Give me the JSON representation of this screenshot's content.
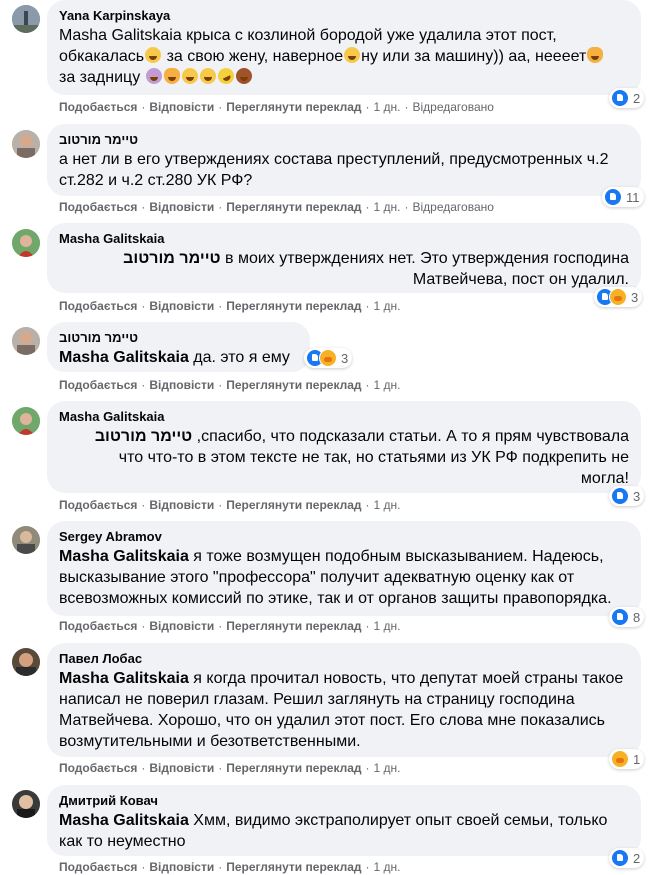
{
  "colors": {
    "bubble": "#f0f2f5",
    "meta": "#65676b",
    "like_blue": "#1877f2",
    "care_yellow": "#f7b125"
  },
  "actions": {
    "like": "Подобається",
    "reply": "Відповісти",
    "translate": "Переглянути переклад",
    "sep": "·"
  },
  "comments": [
    {
      "author": "Yana Karpinskaya",
      "lines": [
        "Masha Galitskaia крыса с козлиной бородой уже удалила этот пост,",
        "обкакалась",
        " за свою жену, наверное",
        "ну или за машину)) аа, неееет",
        "за задницу"
      ],
      "time": "1 дн.",
      "edited": "Відредаговано",
      "reactions": {
        "icons": [
          "like-icon"
        ],
        "count": "2"
      }
    },
    {
      "author": "טיימר מורטוב",
      "text": "а нет ли в его утверждениях состава преступлений, предусмотренных ч.2 ст.282 и ч.2 ст.280 УК РФ?",
      "time": "1 дн.",
      "edited": "Відредаговано",
      "reactions": {
        "icons": [
          "like-icon"
        ],
        "count": "11"
      }
    },
    {
      "author": "Masha Galitskaia",
      "text_before": "в моих утверждениях нет. Это утверждения господина",
      "mention": "טיימר מורטוב",
      "text_after": ".Матвейчева, пост он удалил",
      "time": "1 дн.",
      "reactions": {
        "icons": [
          "like-icon",
          "care-icon"
        ],
        "count": "3"
      }
    },
    {
      "author": "טיימר מורטוב",
      "mention": "Masha Galitskaia",
      "text": "да. это я ему",
      "time": "1 дн.",
      "reactions": {
        "icons": [
          "like-icon",
          "care-icon"
        ],
        "count": "3"
      }
    },
    {
      "author": "Masha Galitskaia",
      "text_before": "спасибо, что подсказали статьи. А то я прям чувствовала,",
      "mention": "טיימר מורטוב",
      "line2": "что что-то в этом тексте не так, но статьями из УК РФ подкрепить не",
      "line3": "!могла",
      "time": "1 дн.",
      "reactions": {
        "icons": [
          "like-icon"
        ],
        "count": "3"
      }
    },
    {
      "author": "Sergey Abramov",
      "mention": "Masha Galitskaia",
      "text": "я тоже возмущен подобным высказыванием. Надеюсь, высказывание этого \"профессора\" получит адекватную оценку как от всевозможных комиссий по этике, так и от органов защиты правопорядка.",
      "time": "1 дн.",
      "reactions": {
        "icons": [
          "like-icon"
        ],
        "count": "8"
      }
    },
    {
      "author": "Павел Лобас",
      "mention": "Masha Galitskaia",
      "text": "я когда прочитал новость, что депутат моей страны такое написал не поверил глазам. Решил заглянуть на страницу господина Матвейчева. Хорошо, что он удалил этот пост. Его слова мне показались возмутительными и безответственными.",
      "time": "1 дн.",
      "reactions": {
        "icons": [
          "care-icon"
        ],
        "count": "1"
      }
    },
    {
      "author": "Дмитрий Ковач",
      "mention": "Masha Galitskaia",
      "text": "Хмм, видимо экстраполирует опыт своей семьи, только как то неуместно",
      "time": "1 дн.",
      "reactions": {
        "icons": [
          "like-icon"
        ],
        "count": "2"
      }
    }
  ]
}
